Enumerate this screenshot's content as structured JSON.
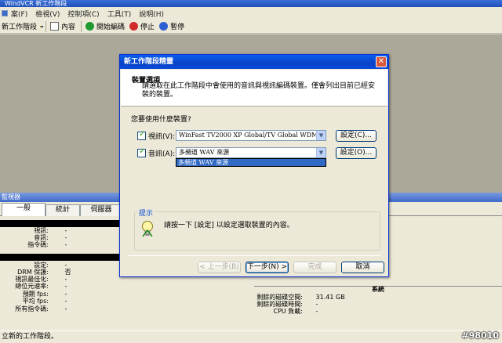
{
  "app": {
    "title_fragment": "WindVCR  新工作階段"
  },
  "menu": {
    "items": [
      "案(F)",
      "檢視(V)",
      "控制項(C)",
      "工具(T)",
      "說明(H)"
    ]
  },
  "toolbar": {
    "new_session": "新工作階段",
    "properties": "內容",
    "start_encoding": "開始編碼",
    "stop": "停止",
    "pause": "暫停"
  },
  "panel": {
    "title": "監視器"
  },
  "tabs": [
    "一般",
    "統計",
    "伺服器"
  ],
  "stats": {
    "group1_labels": [
      "視訊:",
      "音訊:",
      "指令碼:"
    ],
    "group1_values": [
      "-",
      "-",
      "-"
    ],
    "group2_labels": [
      "設定:",
      "DRM 保護:",
      "視訊最佳化:",
      "總位元速率:",
      "預期 fps:",
      "平均 fps:",
      "所有指令碼:"
    ],
    "group2_values": [
      "-",
      "否",
      "-",
      "-",
      "-",
      "-",
      "-"
    ],
    "system_title": "系統",
    "system_labels": [
      "剩餘的磁碟空間:",
      "剩餘的磁碟時間:",
      "CPU 負載:"
    ],
    "system_values": [
      "31.41 GB",
      "-",
      "-"
    ]
  },
  "status": {
    "text": "立新的工作階段。"
  },
  "watermark": "#98010",
  "dialog": {
    "title": "新工作階段精靈",
    "header_title": "裝置選項",
    "header_desc": "請選取在此工作階段中會使用的音訊與視訊編碼裝置。僅會列出目前已經安裝的裝置。",
    "question": "您要使用什麼裝置?",
    "video_label": "視訊(V):",
    "video_device": "WinFast TV2000 XP Global/TV Global WDM Video",
    "audio_label": "音訊(A):",
    "audio_device": "多頻道 WAV 來源",
    "audio_dropdown_option": "多頻道 WAV 來源",
    "config_button": "設定(C)...",
    "config_button2": "設定(O)...",
    "tip_label": "提示",
    "tip_text": "請按一下 [設定] 以設定選取裝置的內容。",
    "back": "< 上一步(B)",
    "next": "下一步(N) >",
    "finish": "完成",
    "cancel": "取消"
  }
}
